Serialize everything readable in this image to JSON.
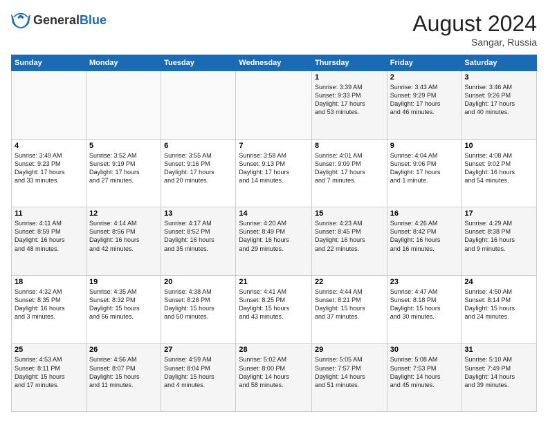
{
  "header": {
    "logo_general": "General",
    "logo_blue": "Blue",
    "month_year": "August 2024",
    "location": "Sangar, Russia"
  },
  "weekdays": [
    "Sunday",
    "Monday",
    "Tuesday",
    "Wednesday",
    "Thursday",
    "Friday",
    "Saturday"
  ],
  "weeks": [
    [
      {
        "day": "",
        "info": ""
      },
      {
        "day": "",
        "info": ""
      },
      {
        "day": "",
        "info": ""
      },
      {
        "day": "",
        "info": ""
      },
      {
        "day": "1",
        "info": "Sunrise: 3:39 AM\nSunset: 9:33 PM\nDaylight: 17 hours\nand 53 minutes."
      },
      {
        "day": "2",
        "info": "Sunrise: 3:43 AM\nSunset: 9:29 PM\nDaylight: 17 hours\nand 46 minutes."
      },
      {
        "day": "3",
        "info": "Sunrise: 3:46 AM\nSunset: 9:26 PM\nDaylight: 17 hours\nand 40 minutes."
      }
    ],
    [
      {
        "day": "4",
        "info": "Sunrise: 3:49 AM\nSunset: 9:23 PM\nDaylight: 17 hours\nand 33 minutes."
      },
      {
        "day": "5",
        "info": "Sunrise: 3:52 AM\nSunset: 9:19 PM\nDaylight: 17 hours\nand 27 minutes."
      },
      {
        "day": "6",
        "info": "Sunrise: 3:55 AM\nSunset: 9:16 PM\nDaylight: 17 hours\nand 20 minutes."
      },
      {
        "day": "7",
        "info": "Sunrise: 3:58 AM\nSunset: 9:13 PM\nDaylight: 17 hours\nand 14 minutes."
      },
      {
        "day": "8",
        "info": "Sunrise: 4:01 AM\nSunset: 9:09 PM\nDaylight: 17 hours\nand 7 minutes."
      },
      {
        "day": "9",
        "info": "Sunrise: 4:04 AM\nSunset: 9:06 PM\nDaylight: 17 hours\nand 1 minute."
      },
      {
        "day": "10",
        "info": "Sunrise: 4:08 AM\nSunset: 9:02 PM\nDaylight: 16 hours\nand 54 minutes."
      }
    ],
    [
      {
        "day": "11",
        "info": "Sunrise: 4:11 AM\nSunset: 8:59 PM\nDaylight: 16 hours\nand 48 minutes."
      },
      {
        "day": "12",
        "info": "Sunrise: 4:14 AM\nSunset: 8:56 PM\nDaylight: 16 hours\nand 42 minutes."
      },
      {
        "day": "13",
        "info": "Sunrise: 4:17 AM\nSunset: 8:52 PM\nDaylight: 16 hours\nand 35 minutes."
      },
      {
        "day": "14",
        "info": "Sunrise: 4:20 AM\nSunset: 8:49 PM\nDaylight: 16 hours\nand 29 minutes."
      },
      {
        "day": "15",
        "info": "Sunrise: 4:23 AM\nSunset: 8:45 PM\nDaylight: 16 hours\nand 22 minutes."
      },
      {
        "day": "16",
        "info": "Sunrise: 4:26 AM\nSunset: 8:42 PM\nDaylight: 16 hours\nand 16 minutes."
      },
      {
        "day": "17",
        "info": "Sunrise: 4:29 AM\nSunset: 8:38 PM\nDaylight: 16 hours\nand 9 minutes."
      }
    ],
    [
      {
        "day": "18",
        "info": "Sunrise: 4:32 AM\nSunset: 8:35 PM\nDaylight: 16 hours\nand 3 minutes."
      },
      {
        "day": "19",
        "info": "Sunrise: 4:35 AM\nSunset: 8:32 PM\nDaylight: 15 hours\nand 56 minutes."
      },
      {
        "day": "20",
        "info": "Sunrise: 4:38 AM\nSunset: 8:28 PM\nDaylight: 15 hours\nand 50 minutes."
      },
      {
        "day": "21",
        "info": "Sunrise: 4:41 AM\nSunset: 8:25 PM\nDaylight: 15 hours\nand 43 minutes."
      },
      {
        "day": "22",
        "info": "Sunrise: 4:44 AM\nSunset: 8:21 PM\nDaylight: 15 hours\nand 37 minutes."
      },
      {
        "day": "23",
        "info": "Sunrise: 4:47 AM\nSunset: 8:18 PM\nDaylight: 15 hours\nand 30 minutes."
      },
      {
        "day": "24",
        "info": "Sunrise: 4:50 AM\nSunset: 8:14 PM\nDaylight: 15 hours\nand 24 minutes."
      }
    ],
    [
      {
        "day": "25",
        "info": "Sunrise: 4:53 AM\nSunset: 8:11 PM\nDaylight: 15 hours\nand 17 minutes."
      },
      {
        "day": "26",
        "info": "Sunrise: 4:56 AM\nSunset: 8:07 PM\nDaylight: 15 hours\nand 11 minutes."
      },
      {
        "day": "27",
        "info": "Sunrise: 4:59 AM\nSunset: 8:04 PM\nDaylight: 15 hours\nand 4 minutes."
      },
      {
        "day": "28",
        "info": "Sunrise: 5:02 AM\nSunset: 8:00 PM\nDaylight: 14 hours\nand 58 minutes."
      },
      {
        "day": "29",
        "info": "Sunrise: 5:05 AM\nSunset: 7:57 PM\nDaylight: 14 hours\nand 51 minutes."
      },
      {
        "day": "30",
        "info": "Sunrise: 5:08 AM\nSunset: 7:53 PM\nDaylight: 14 hours\nand 45 minutes."
      },
      {
        "day": "31",
        "info": "Sunrise: 5:10 AM\nSunset: 7:49 PM\nDaylight: 14 hours\nand 39 minutes."
      }
    ]
  ]
}
